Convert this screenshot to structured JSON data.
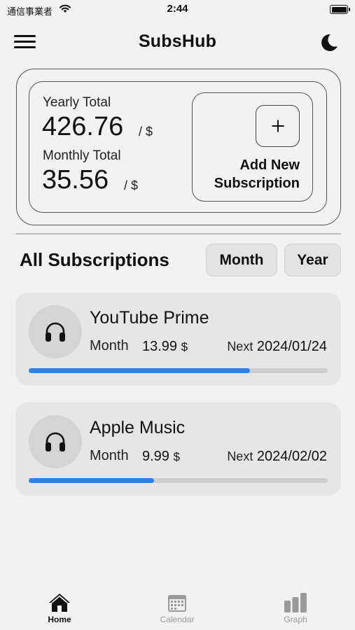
{
  "status_bar": {
    "carrier": "通信事業者",
    "time": "2:44",
    "battery_level": 1.0
  },
  "header": {
    "title": "SubsHub",
    "menu_icon": "hamburger-menu-icon",
    "theme_icon": "moon-icon"
  },
  "summary": {
    "yearly_label": "Yearly Total",
    "yearly_value": "426.76",
    "yearly_unit": "/ $",
    "monthly_label": "Monthly Total",
    "monthly_value": "35.56",
    "monthly_unit": "/ $",
    "add_button": {
      "icon": "plus-icon",
      "line1": "Add New",
      "line2": "Subscription"
    }
  },
  "section": {
    "title": "All Subscriptions",
    "filters": [
      "Month",
      "Year"
    ]
  },
  "subscriptions": [
    {
      "name": "YouTube Prime",
      "cycle": "Month",
      "price": "13.99",
      "currency": "$",
      "next_label": "Next",
      "next_date": "2024/01/24",
      "progress": 0.74,
      "icon": "headphones-icon"
    },
    {
      "name": "Apple Music",
      "cycle": "Month",
      "price": "9.99",
      "currency": "$",
      "next_label": "Next",
      "next_date": "2024/02/02",
      "progress": 0.42,
      "icon": "headphones-icon"
    }
  ],
  "tabs": [
    {
      "label": "Home",
      "icon": "home-icon",
      "active": true
    },
    {
      "label": "Calendar",
      "icon": "calendar-icon",
      "active": false
    },
    {
      "label": "Graph",
      "icon": "bar-chart-icon",
      "active": false
    }
  ],
  "colors": {
    "background": "#f2f2f2",
    "card": "#e6e6e6",
    "progress_fill": "#2a84f0",
    "progress_track": "#cfcfcf",
    "tab_active": "#111111",
    "tab_inactive": "#9a9a9a"
  }
}
